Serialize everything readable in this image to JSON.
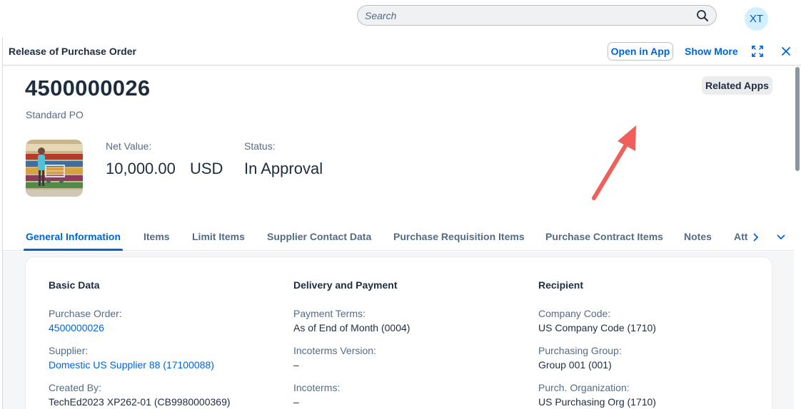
{
  "shell": {
    "search_placeholder": "Search",
    "avatar_initials": "XT"
  },
  "dialog": {
    "title": "Release of Purchase Order",
    "open_in_app": "Open in App",
    "show_more": "Show More"
  },
  "header": {
    "po_number": "4500000026",
    "po_type": "Standard PO",
    "related_apps": "Related Apps",
    "net_value_label": "Net Value:",
    "net_value": "10,000.00",
    "currency": "USD",
    "status_label": "Status:",
    "status_value": "In Approval"
  },
  "tabs": [
    {
      "label": "General Information",
      "active": true
    },
    {
      "label": "Items"
    },
    {
      "label": "Limit Items"
    },
    {
      "label": "Supplier Contact Data"
    },
    {
      "label": "Purchase Requisition Items"
    },
    {
      "label": "Purchase Contract Items"
    },
    {
      "label": "Notes"
    },
    {
      "label": "Att"
    }
  ],
  "sections": {
    "basic": {
      "title": "Basic Data",
      "fields": [
        {
          "label": "Purchase Order:",
          "value": "4500000026"
        },
        {
          "label": "Supplier:",
          "value": "Domestic US Supplier 88 (17100088)"
        },
        {
          "label": "Created By:",
          "value": "TechEd2023 XP262-01 (CB9980000369)"
        }
      ]
    },
    "delivery": {
      "title": "Delivery and Payment",
      "fields": [
        {
          "label": "Payment Terms:",
          "value": "As of End of Month (0004)"
        },
        {
          "label": "Incoterms Version:",
          "value": "–"
        },
        {
          "label": "Incoterms:",
          "value": "–"
        }
      ]
    },
    "recipient": {
      "title": "Recipient",
      "fields": [
        {
          "label": "Company Code:",
          "value": "US Company Code (1710)"
        },
        {
          "label": "Purchasing Group:",
          "value": "Group 001 (001)"
        },
        {
          "label": "Purch. Organization:",
          "value": "US Purchasing Org (1710)"
        }
      ]
    }
  },
  "colors": {
    "accent": "#0064d9",
    "annotation_arrow": "#f0605a",
    "text": "#1d2d3e",
    "label": "#556b82"
  },
  "icons": [
    "search-icon",
    "fullscreen-icon",
    "close-icon",
    "chevron-right-icon",
    "chevron-down-icon"
  ]
}
